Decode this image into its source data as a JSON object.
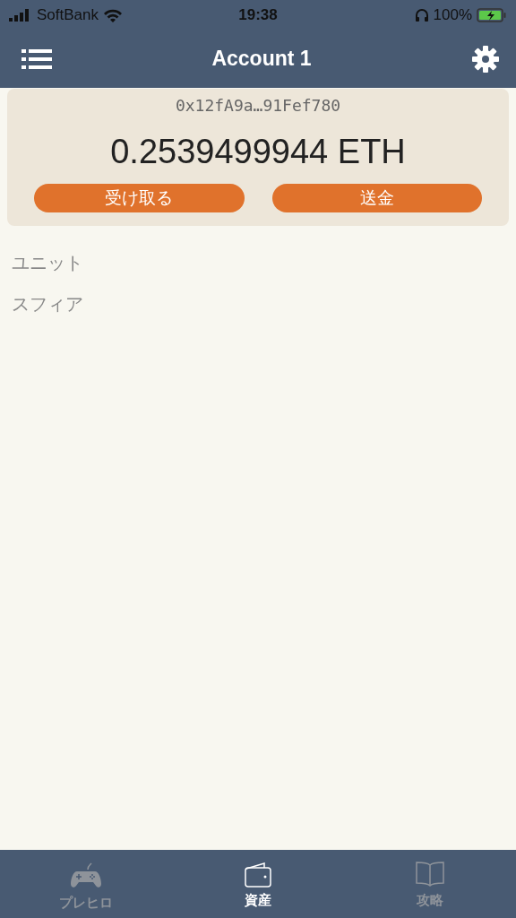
{
  "status_bar": {
    "carrier": "SoftBank",
    "time": "19:38",
    "battery": "100%"
  },
  "nav": {
    "title": "Account 1"
  },
  "wallet": {
    "address": "0x12fA9a…91Fef780",
    "balance": "0.2539499944 ETH",
    "buttons": [
      "受け取る",
      "送金"
    ]
  },
  "assets": [
    "ユニット",
    "スフィア"
  ],
  "tabs": [
    {
      "label": "プレヒロ",
      "kind": "gamepad",
      "selected": false
    },
    {
      "label": "資産",
      "kind": "wallet",
      "selected": true
    },
    {
      "label": "攻略",
      "kind": "book",
      "selected": false
    }
  ]
}
